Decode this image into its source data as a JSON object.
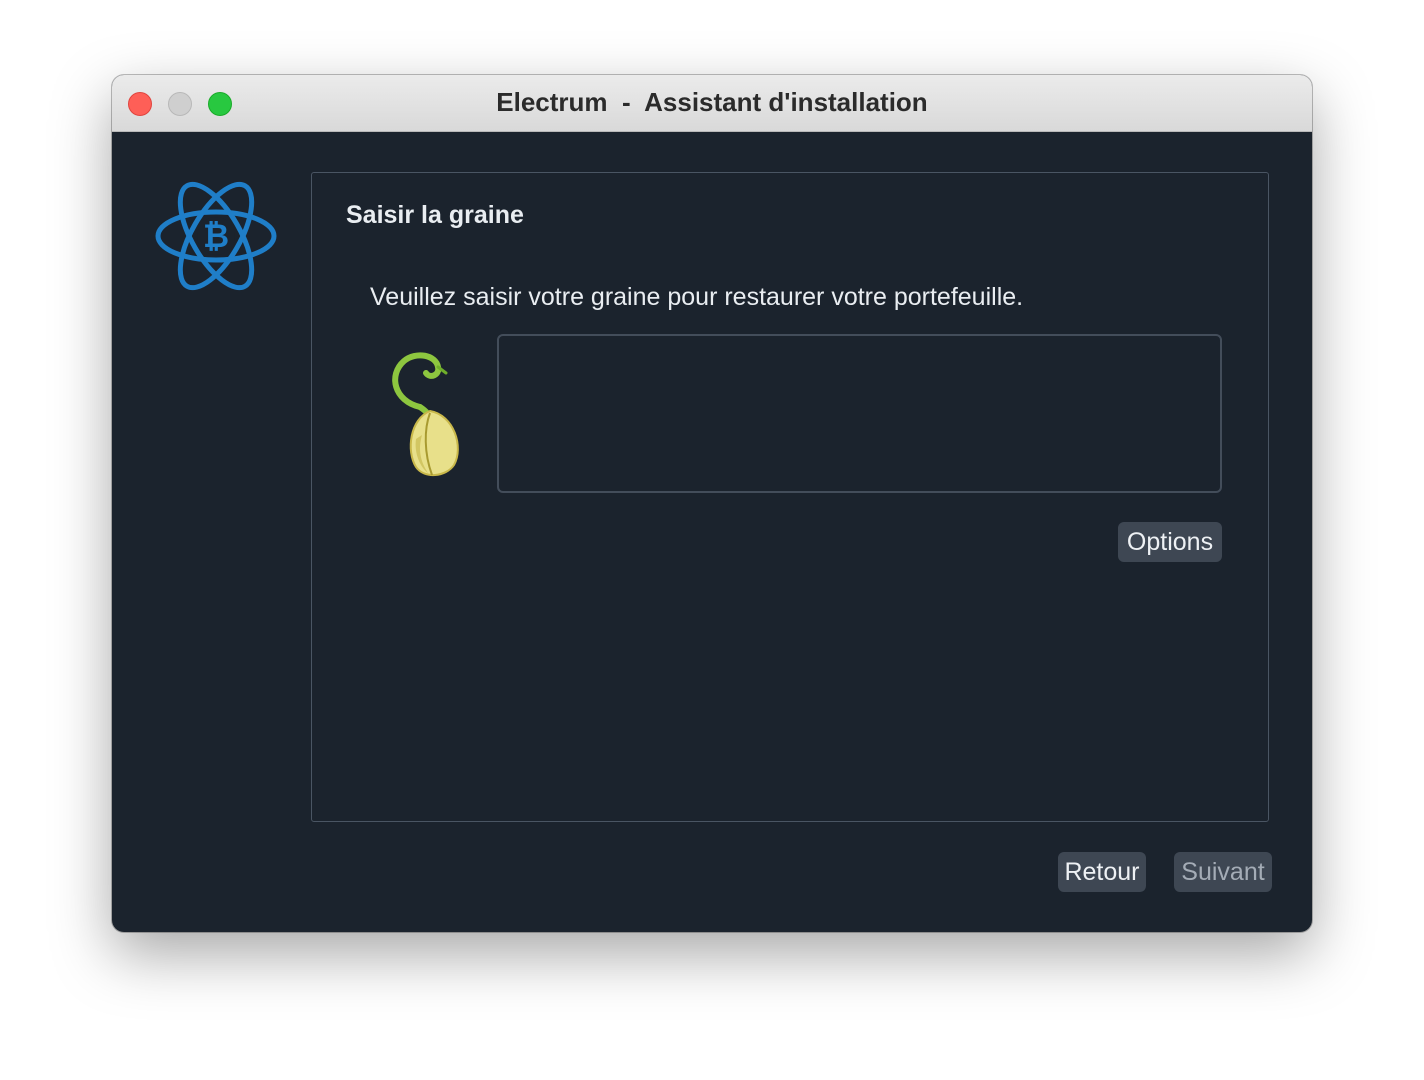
{
  "window": {
    "title": "Electrum  -  Assistant d'installation",
    "traffic_lights": [
      "close",
      "minimize",
      "zoom"
    ]
  },
  "logo": {
    "icon": "electrum-bitcoin-logo-icon",
    "color": "#1f7ec8"
  },
  "panel": {
    "title": "Saisir la graine",
    "message": "Veuillez saisir votre graine pour restaurer votre portefeuille.",
    "seed_icon": "seed-sprout-icon",
    "seed_value": "",
    "options_label": "Options"
  },
  "footer": {
    "back_label": "Retour",
    "next_label": "Suivant"
  },
  "colors": {
    "background": "#1b232d",
    "text": "#e9edf1",
    "button_bg": "#3e4753",
    "button_disabled_text": "#a4acb6",
    "accent_blue": "#1f7ec8"
  }
}
